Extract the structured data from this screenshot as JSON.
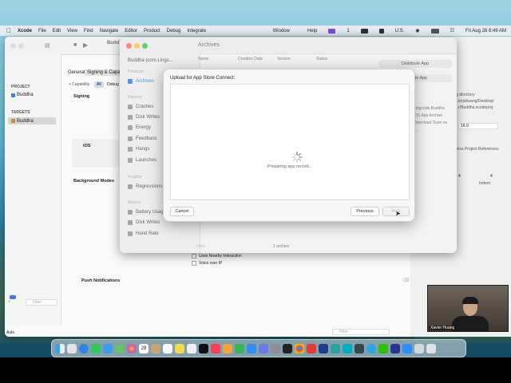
{
  "menubar": {
    "app": "Xcode",
    "items": [
      "File",
      "Edit",
      "View",
      "Find",
      "Navigate",
      "Editor",
      "Product",
      "Debug",
      "Integrate"
    ],
    "window_item": "Window",
    "help_item": "Help",
    "badge": "1",
    "input_source": "U.S.",
    "datetime": "Fri Aug 28  8:49 AM"
  },
  "xcode": {
    "toolbar_title": "Buddha",
    "tabs": [
      "General",
      "Signing & Capabilities"
    ],
    "capability_label": "+ Capability",
    "filter_all": "All",
    "filter_debug": "Debug",
    "project_header": "PROJECT",
    "project_name": "Buddha",
    "targets_header": "TARGETS",
    "target_name": "Buddha",
    "signing_label": "Signing",
    "ios_label": "iOS",
    "background_modes_label": "Background Modes",
    "modes": [
      "Uses Nearby Interaction",
      "Voice over IP"
    ],
    "push_label": "Push Notifications",
    "filter_placeholder": "Filter",
    "auto_label": "Auto",
    "right_panel": {
      "lines": [
        "ting directory",
        "...ierjahuang/Desktop/",
        "...r/Buddha.xcodeproj"
      ],
      "version": "16.0",
      "refs_label": "mize Project References",
      "indent_label": "Indent",
      "num1": "4",
      "num2": "4"
    }
  },
  "archives": {
    "title": "Archives",
    "scheme": "Buddha (com.Lingc...",
    "products_header": "Products",
    "columns": [
      "Name",
      "Creation Date",
      "Version",
      "Status"
    ],
    "sidebar": [
      {
        "label": "Archives",
        "selected": true
      },
      {
        "label": "Crashes"
      },
      {
        "label": "Disk Writes"
      },
      {
        "label": "Energy"
      },
      {
        "label": "Feedback"
      },
      {
        "label": "Hangs"
      },
      {
        "label": "Launches"
      },
      {
        "label": "Regressions"
      },
      {
        "label": "Battery Usage"
      },
      {
        "label": "Disk Writes"
      },
      {
        "label": "Hand Rate"
      }
    ],
    "reports_header": "Reports",
    "insights_header": "Insights",
    "metrics_header": "Metrics",
    "distribute_button": "Distribute App",
    "validate_button": "Validate App",
    "detail_lines": [
      "Lingcode.Buddha",
      "iOS App Archive",
      "Download Team ex",
      "..."
    ],
    "filter_placeholder": "Filter",
    "count_label": "1 archive"
  },
  "modal": {
    "title": "Upload for App Store Connect:",
    "status": "Preparing app record...",
    "cancel": "Cancel",
    "previous": "Previous",
    "next": "Next"
  },
  "webcam": {
    "name": "Xavier Huang"
  },
  "dock": {
    "calendar_day": "28"
  }
}
